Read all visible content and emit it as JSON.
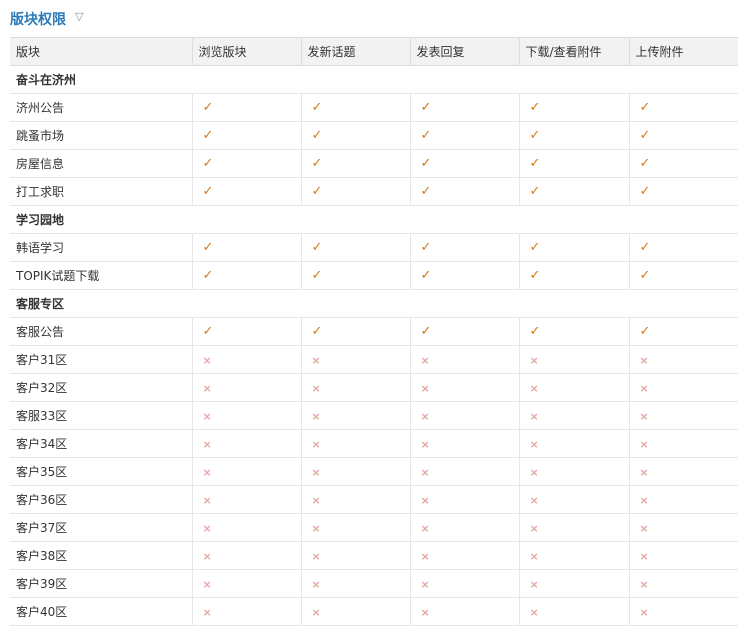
{
  "title": "版块权限",
  "toggle_icon": "triangle-down-icon",
  "colors": {
    "title": "#2b7bb9",
    "allowed": "#d2781e",
    "denied": "#e7a49f",
    "header_bg": "#f2f2f2"
  },
  "marks": {
    "allowed": "✓",
    "denied": "×"
  },
  "columns": [
    "版块",
    "浏览版块",
    "发新话题",
    "发表回复",
    "下载/查看附件",
    "上传附件"
  ],
  "groups": [
    {
      "name": "奋斗在济州",
      "forums": [
        {
          "name": "济州公告",
          "perms": [
            true,
            true,
            true,
            true,
            true
          ]
        },
        {
          "name": "跳蚤市场",
          "perms": [
            true,
            true,
            true,
            true,
            true
          ]
        },
        {
          "name": "房屋信息",
          "perms": [
            true,
            true,
            true,
            true,
            true
          ]
        },
        {
          "name": "打工求职",
          "perms": [
            true,
            true,
            true,
            true,
            true
          ]
        }
      ]
    },
    {
      "name": "学习园地",
      "forums": [
        {
          "name": "韩语学习",
          "perms": [
            true,
            true,
            true,
            true,
            true
          ]
        },
        {
          "name": "TOPIK试题下载",
          "perms": [
            true,
            true,
            true,
            true,
            true
          ]
        }
      ]
    },
    {
      "name": "客服专区",
      "forums": [
        {
          "name": "客服公告",
          "perms": [
            true,
            true,
            true,
            true,
            true
          ]
        },
        {
          "name": "客户31区",
          "perms": [
            false,
            false,
            false,
            false,
            false
          ]
        },
        {
          "name": "客户32区",
          "perms": [
            false,
            false,
            false,
            false,
            false
          ]
        },
        {
          "name": "客服33区",
          "perms": [
            false,
            false,
            false,
            false,
            false
          ]
        },
        {
          "name": "客户34区",
          "perms": [
            false,
            false,
            false,
            false,
            false
          ]
        },
        {
          "name": "客户35区",
          "perms": [
            false,
            false,
            false,
            false,
            false
          ]
        },
        {
          "name": "客户36区",
          "perms": [
            false,
            false,
            false,
            false,
            false
          ]
        },
        {
          "name": "客户37区",
          "perms": [
            false,
            false,
            false,
            false,
            false
          ]
        },
        {
          "name": "客户38区",
          "perms": [
            false,
            false,
            false,
            false,
            false
          ]
        },
        {
          "name": "客户39区",
          "perms": [
            false,
            false,
            false,
            false,
            false
          ]
        },
        {
          "name": "客户40区",
          "perms": [
            false,
            false,
            false,
            false,
            false
          ]
        }
      ]
    }
  ]
}
